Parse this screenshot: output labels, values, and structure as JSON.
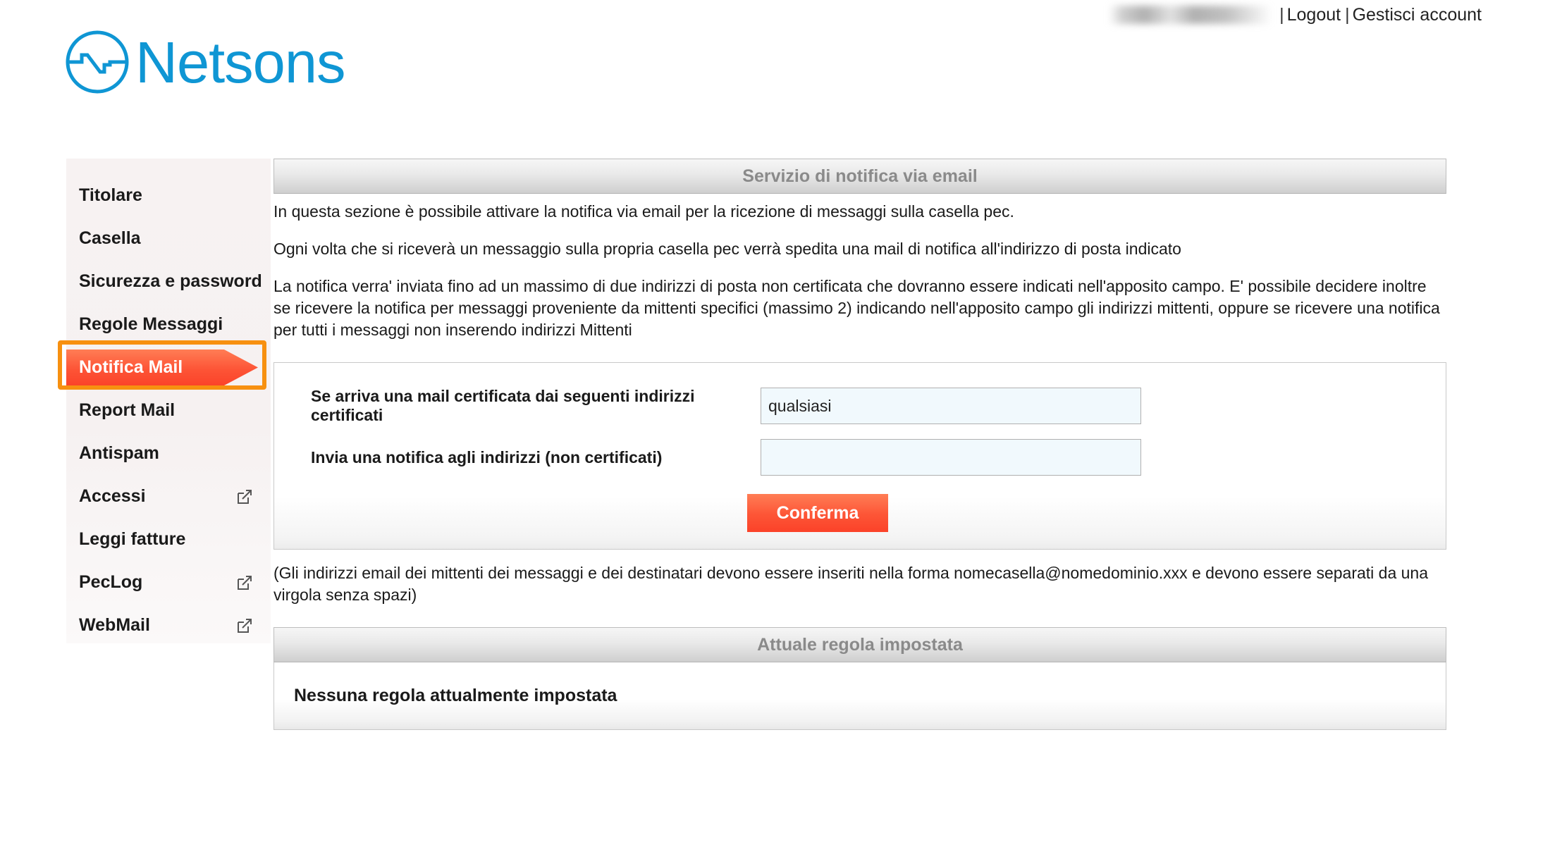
{
  "topbar": {
    "username_redacted": true,
    "separator": "|",
    "logout_label": "Logout",
    "account_label": "Gestisci account"
  },
  "brand": {
    "wordmark": "Netsons",
    "logo_icon": "netsons-circle-waveform-icon",
    "color": "#0f96d4"
  },
  "sidebar": {
    "items": [
      {
        "label": "Titolare",
        "active": false,
        "external": false
      },
      {
        "label": "Casella",
        "active": false,
        "external": false
      },
      {
        "label": "Sicurezza e password",
        "active": false,
        "external": false
      },
      {
        "label": "Regole Messaggi",
        "active": false,
        "external": false
      },
      {
        "label": "Notifica Mail",
        "active": true,
        "external": false
      },
      {
        "label": "Report Mail",
        "active": false,
        "external": false
      },
      {
        "label": "Antispam",
        "active": false,
        "external": false
      },
      {
        "label": "Accessi",
        "active": false,
        "external": true
      },
      {
        "label": "Leggi fatture",
        "active": false,
        "external": false
      },
      {
        "label": "PecLog",
        "active": false,
        "external": true
      },
      {
        "label": "WebMail",
        "active": false,
        "external": true
      }
    ],
    "active_highlight_color": "#f79010",
    "active_item_color": "#fd5436"
  },
  "main": {
    "service_header": "Servizio di notifica via email",
    "intro_paragraphs": [
      "In questa sezione è possibile attivare la notifica via email per la ricezione di messaggi sulla casella pec.",
      "Ogni volta che si riceverà un messaggio sulla propria casella pec verrà spedita una mail di notifica all'indirizzo di posta indicato",
      "La notifica verra' inviata fino ad un massimo di due indirizzi di posta non certificata che dovranno essere indicati nell'apposito campo. E' possibile decidere inoltre se ricevere la notifica per messaggi proveniente da mittenti specifici (massimo 2) indicando nell'apposito campo gli indirizzi mittenti, oppure se ricevere una notifica per tutti i messaggi non inserendo indirizzi Mittenti"
    ],
    "form": {
      "sender_label": "Se arriva una mail certificata dai seguenti indirizzi certificati",
      "sender_value": "qualsiasi",
      "sender_placeholder": "",
      "recipient_label": "Invia una notifica agli indirizzi (non certificati)",
      "recipient_value": "",
      "recipient_placeholder": "",
      "submit_label": "Conferma"
    },
    "footnote": "(Gli indirizzi email dei mittenti dei messaggi e dei destinatari devono essere inseriti nella forma nomecasella@nomedominio.xxx e devono essere separati da una virgola senza spazi)",
    "rule_header": "Attuale regola impostata",
    "rule_body": "Nessuna regola attualmente impostata"
  }
}
